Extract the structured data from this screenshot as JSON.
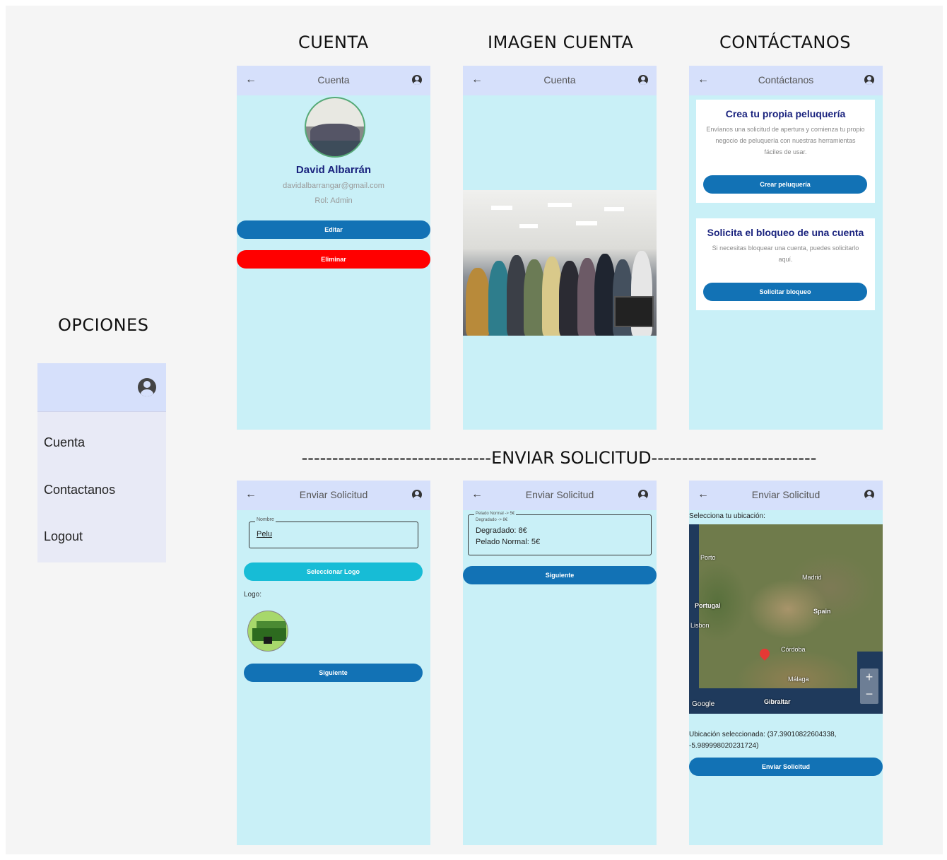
{
  "sections": {
    "cuenta": "CUENTA",
    "imagen_cuenta": "IMAGEN CUENTA",
    "contactanos": "CONTÁCTANOS",
    "opciones": "OPCIONES",
    "enviar_solicitud": "-------------------------------ENVIAR SOLICITUD---------------------------"
  },
  "sidebar": {
    "items": [
      {
        "label": "Cuenta"
      },
      {
        "label": "Contactanos"
      },
      {
        "label": "Logout"
      }
    ]
  },
  "screen_cuenta": {
    "title": "Cuenta",
    "name": "David Albarrán",
    "email": "davidalbarrangar@gmail.com",
    "role": "Rol: Admin",
    "edit_label": "Editar",
    "delete_label": "Eliminar"
  },
  "screen_imagen": {
    "title": "Cuenta"
  },
  "screen_contacto": {
    "title": "Contáctanos",
    "card1": {
      "heading": "Crea tu propia peluquería",
      "body": "Envíanos una solicitud de apertura y comienza tu propio negocio de peluquería con nuestras herramientas fáciles de usar.",
      "button": "Crear peluquería"
    },
    "card2": {
      "heading": "Solicita el bloqueo de una cuenta",
      "body": "Si necesitas bloquear una cuenta, puedes solicitarlo aquí.",
      "button": "Solicitar bloqueo"
    }
  },
  "screen_solicitud1": {
    "title": "Enviar Solicitud",
    "field_label": "Nombre",
    "field_value": "Pelu",
    "select_logo": "Seleccionar Logo",
    "logo_label": "Logo:",
    "next": "Siguiente"
  },
  "screen_solicitud2": {
    "title": "Enviar Solicitud",
    "field_label_1": "Pelado Normal -> 5€",
    "field_label_2": "Degradado -> 8€",
    "line1": "Degradado: 8€",
    "line2": "Pelado Normal: 5€",
    "next": "Siguiente"
  },
  "screen_solicitud3": {
    "title": "Enviar Solicitud",
    "prompt": "Selecciona tu ubicación:",
    "map_labels": {
      "porto": "Porto",
      "portugal": "Portugal",
      "madrid": "Madrid",
      "spain": "Spain",
      "lisbon": "Lisbon",
      "cordoba": "Córdoba",
      "malaga": "Málaga",
      "gibraltar": "Gibraltar",
      "google": "Google",
      "zoom_in": "+",
      "zoom_out": "−"
    },
    "selected": "Ubicación seleccionada: (37.39010822604338, -5.989998020231724)",
    "submit": "Enviar Solicitud"
  }
}
